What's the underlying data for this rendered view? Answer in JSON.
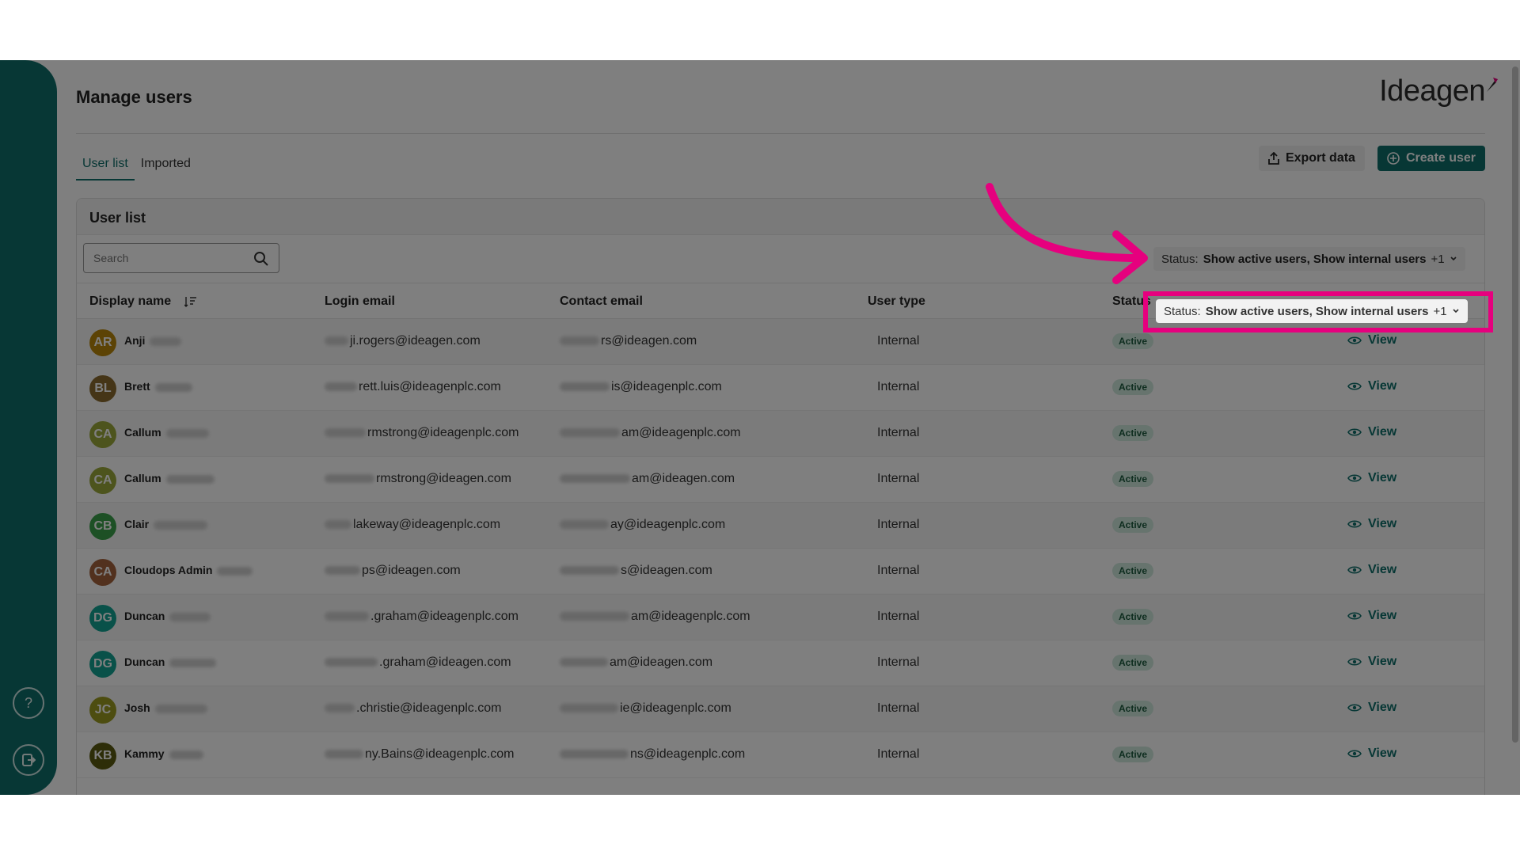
{
  "header": {
    "page_title": "Manage users",
    "logo_text": "Ideagen"
  },
  "tabs": [
    {
      "label": "User list",
      "active": true
    },
    {
      "label": "Imported",
      "active": false
    }
  ],
  "toolbar": {
    "export_label": "Export data",
    "create_label": "Create user"
  },
  "panel": {
    "title": "User list",
    "search_placeholder": "Search",
    "status_filter": {
      "prefix": "Status:",
      "value": "Show active users, Show internal users",
      "extra": "+1"
    }
  },
  "table": {
    "columns": [
      "Display name",
      "Login email",
      "Contact email",
      "User type",
      "Status"
    ],
    "rows": [
      {
        "initials": "AR",
        "first": "Anji",
        "login": "ji.rogers@ideagen.com",
        "contact": "rs@ideagen.com",
        "type": "Internal",
        "status": "Active",
        "action": "View",
        "color": "#b8860b"
      },
      {
        "initials": "BL",
        "first": "Brett",
        "login": "rett.luis@ideagenplc.com",
        "contact": "is@ideagenplc.com",
        "type": "Internal",
        "status": "Active",
        "action": "View",
        "color": "#8b6b2e"
      },
      {
        "initials": "CA",
        "first": "Callum",
        "login": "rmstrong@ideagenplc.com",
        "contact": "am@ideagenplc.com",
        "type": "Internal",
        "status": "Active",
        "action": "View",
        "color": "#9aa83a"
      },
      {
        "initials": "CA",
        "first": "Callum",
        "login": "rmstrong@ideagen.com",
        "contact": "am@ideagen.com",
        "type": "Internal",
        "status": "Active",
        "action": "View",
        "color": "#9aa83a"
      },
      {
        "initials": "CB",
        "first": "Clair",
        "login": "lakeway@ideagenplc.com",
        "contact": "ay@ideagenplc.com",
        "type": "Internal",
        "status": "Active",
        "action": "View",
        "color": "#3aa04a"
      },
      {
        "initials": "CA",
        "first": "Cloudops Admin",
        "login": "ps@ideagen.com",
        "contact": "s@ideagen.com",
        "type": "Internal",
        "status": "Active",
        "action": "View",
        "color": "#a5633d"
      },
      {
        "initials": "DG",
        "first": "Duncan",
        "login": ".graham@ideagenplc.com",
        "contact": "am@ideagenplc.com",
        "type": "Internal",
        "status": "Active",
        "action": "View",
        "color": "#12a292"
      },
      {
        "initials": "DG",
        "first": "Duncan",
        "login": ".graham@ideagen.com",
        "contact": "am@ideagen.com",
        "type": "Internal",
        "status": "Active",
        "action": "View",
        "color": "#12a292"
      },
      {
        "initials": "JC",
        "first": "Josh",
        "login": ".christie@ideagenplc.com",
        "contact": "ie@ideagenplc.com",
        "type": "Internal",
        "status": "Active",
        "action": "View",
        "color": "#9a9a20"
      },
      {
        "initials": "KB",
        "first": "Kammy",
        "login": "ny.Bains@ideagenplc.com",
        "contact": "ns@ideagenplc.com",
        "type": "Internal",
        "status": "Active",
        "action": "View",
        "color": "#5a5a10"
      }
    ]
  },
  "sidebar": {
    "help_icon": "help-icon",
    "logout_icon": "logout-icon"
  },
  "colors": {
    "brand": "#0e6f6a",
    "highlight": "#e6007e",
    "badge_bg": "#cfe8dd"
  }
}
